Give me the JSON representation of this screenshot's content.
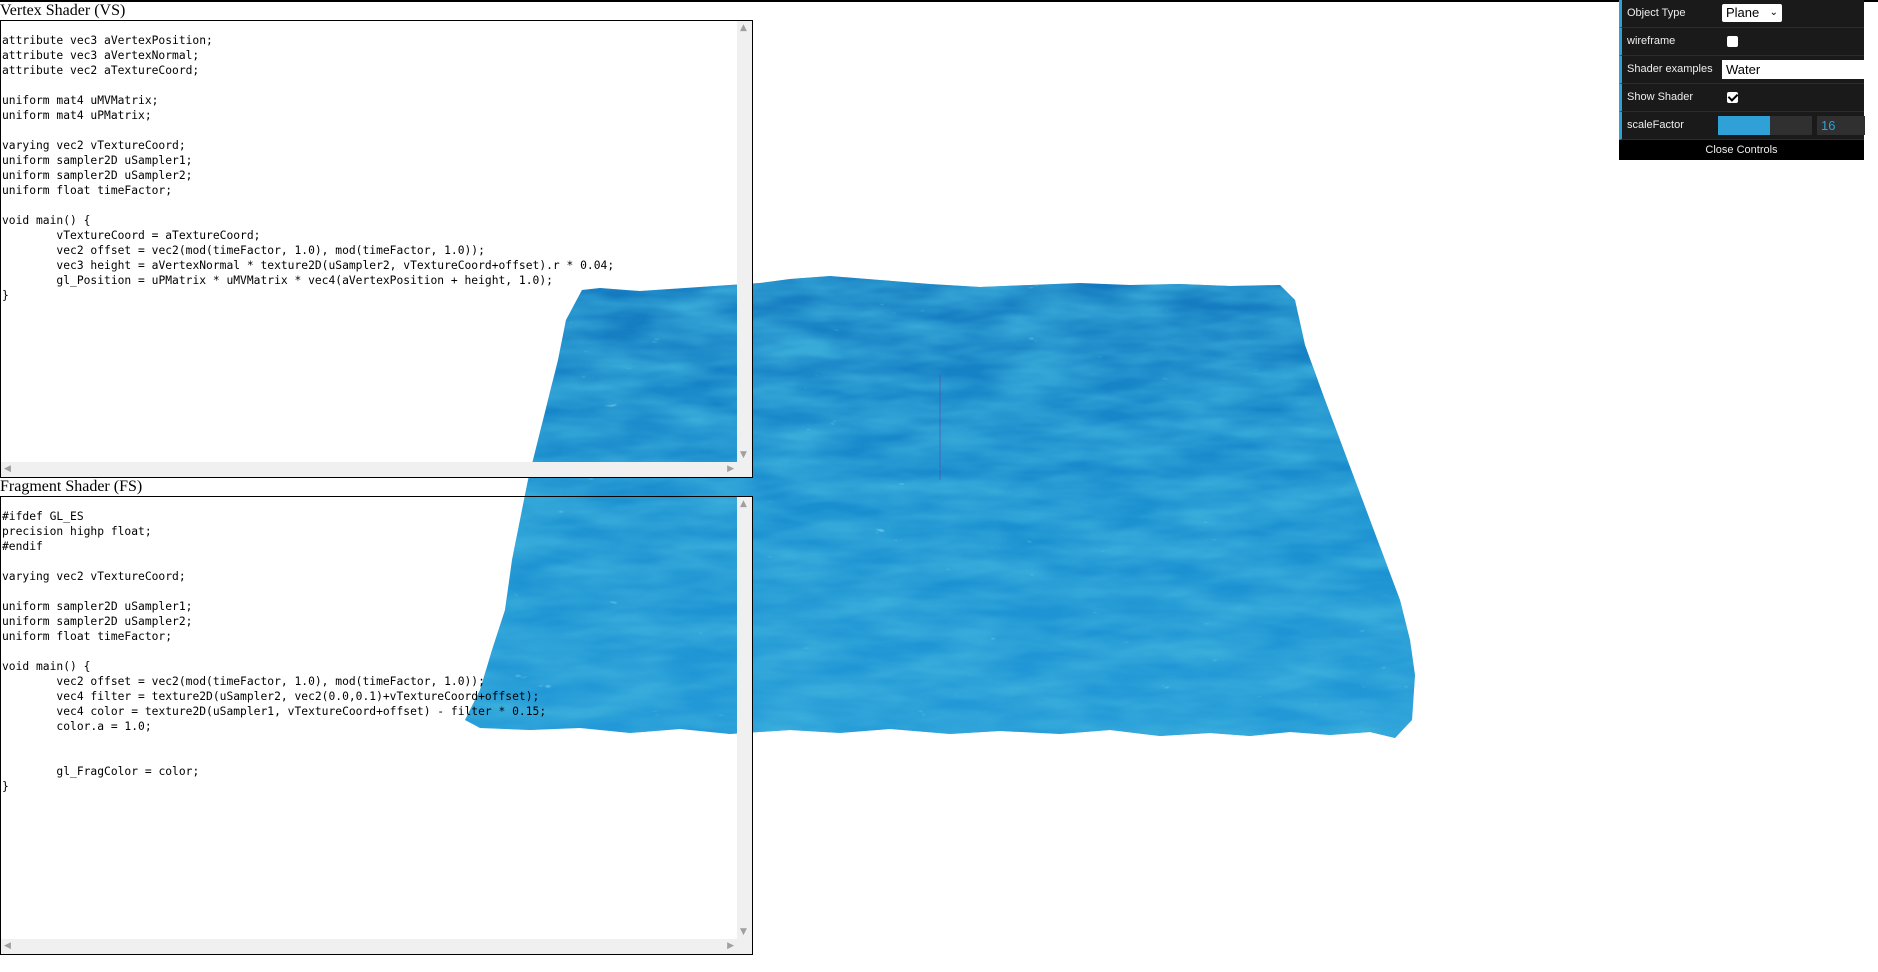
{
  "vertex_shader": {
    "title": "Vertex Shader (VS)",
    "code": "attribute vec3 aVertexPosition;\nattribute vec3 aVertexNormal;\nattribute vec2 aTextureCoord;\n\nuniform mat4 uMVMatrix;\nuniform mat4 uPMatrix;\n\nvarying vec2 vTextureCoord;\nuniform sampler2D uSampler1;\nuniform sampler2D uSampler2;\nuniform float timeFactor;\n\nvoid main() {\n\tvTextureCoord = aTextureCoord;\n\tvec2 offset = vec2(mod(timeFactor, 1.0), mod(timeFactor, 1.0));\n\tvec3 height = aVertexNormal * texture2D(uSampler2, vTextureCoord+offset).r * 0.04;\n\tgl_Position = uPMatrix * uMVMatrix * vec4(aVertexPosition + height, 1.0);\n}"
  },
  "fragment_shader": {
    "title": "Fragment Shader (FS)",
    "code": "#ifdef GL_ES\nprecision highp float;\n#endif\n\nvarying vec2 vTextureCoord;\n\nuniform sampler2D uSampler1;\nuniform sampler2D uSampler2;\nuniform float timeFactor;\n\nvoid main() {\n\tvec2 offset = vec2(mod(timeFactor, 1.0), mod(timeFactor, 1.0));\n\tvec4 filter = texture2D(uSampler2, vec2(0.0,0.1)+vTextureCoord+offset);\n\tvec4 color = texture2D(uSampler1, vTextureCoord+offset) - filter * 0.15;\n\tcolor.a = 1.0;\n\n\n\tgl_FragColor = color;\n}"
  },
  "controls": {
    "object_type": {
      "label": "Object Type",
      "value": "Plane"
    },
    "wireframe": {
      "label": "wireframe",
      "checked": false
    },
    "shader_examples": {
      "label": "Shader examples",
      "value": "Water"
    },
    "show_shader": {
      "label": "Show Shader",
      "checked": true
    },
    "scale_factor": {
      "label": "scaleFactor",
      "value": "16",
      "fill_fraction": 0.55
    },
    "close_label": "Close Controls"
  },
  "colors": {
    "accent": "#2fa1d6",
    "water_base": "#1a8fd0",
    "water_dark": "#0d6fae",
    "water_light": "#3db9ea"
  },
  "icons": {
    "select_chevron": "chevron-down-icon",
    "checkbox_check": "check-icon",
    "scroll_up": "scroll-up-icon",
    "scroll_down": "scroll-down-icon",
    "scroll_left": "scroll-left-icon",
    "scroll_right": "scroll-right-icon"
  }
}
